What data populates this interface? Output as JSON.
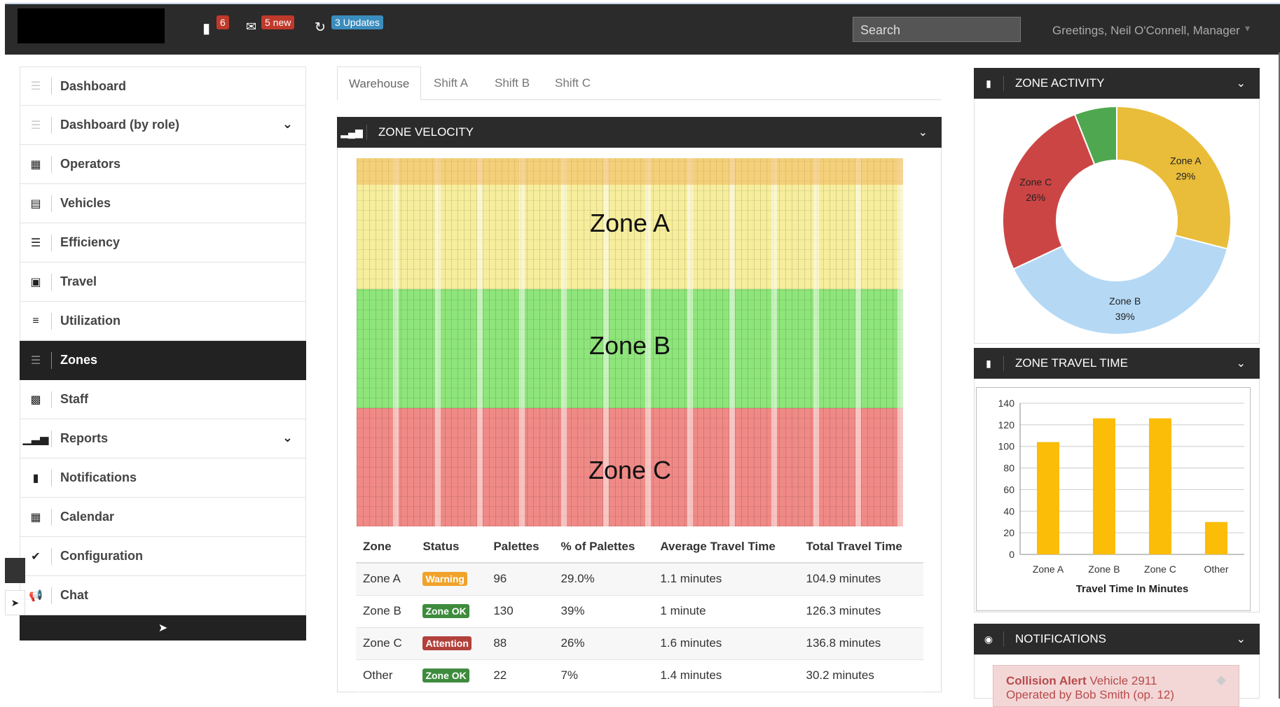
{
  "topbar": {
    "messages_count": "6",
    "mail_badge": "5 new",
    "updates_badge": "3 Updates",
    "search_placeholder": "Search",
    "greeting": "Greetings, Neil O'Connell, Manager"
  },
  "sidebar": {
    "items": [
      {
        "label": "Dashboard",
        "icon": "dashboard-icon"
      },
      {
        "label": "Dashboard (by role)",
        "icon": "dashboard-icon"
      },
      {
        "label": "Operators",
        "icon": "grid-icon"
      },
      {
        "label": "Vehicles",
        "icon": "list-icon"
      },
      {
        "label": "Efficiency",
        "icon": "stack-icon"
      },
      {
        "label": "Travel",
        "icon": "picture-icon"
      },
      {
        "label": "Utilization",
        "icon": "align-icon"
      },
      {
        "label": "Zones",
        "icon": "zones-icon"
      },
      {
        "label": "Staff",
        "icon": "gift-icon"
      },
      {
        "label": "Reports",
        "icon": "bar-chart-icon"
      },
      {
        "label": "Notifications",
        "icon": "comment-icon"
      },
      {
        "label": "Calendar",
        "icon": "calendar-icon"
      },
      {
        "label": "Configuration",
        "icon": "check-icon"
      },
      {
        "label": "Chat",
        "icon": "megaphone-icon"
      }
    ]
  },
  "tabs": [
    "Warehouse",
    "Shift A",
    "Shift B",
    "Shift C"
  ],
  "zone_velocity": {
    "title": "ZONE VELOCITY",
    "zones": [
      "Zone A",
      "Zone B",
      "Zone C"
    ],
    "table": {
      "headers": [
        "Zone",
        "Status",
        "Palettes",
        "% of Palettes",
        "Average Travel Time",
        "Total Travel Time"
      ],
      "rows": [
        {
          "zone": "Zone A",
          "status": "Warning",
          "palettes": "96",
          "pct": "29.0%",
          "avg": "1.1 minutes",
          "total": "104.9 minutes"
        },
        {
          "zone": "Zone B",
          "status": "Zone OK",
          "palettes": "130",
          "pct": "39%",
          "avg": "1 minute",
          "total": "126.3 minutes"
        },
        {
          "zone": "Zone C",
          "status": "Attention",
          "palettes": "88",
          "pct": "26%",
          "avg": "1.6 minutes",
          "total": "136.8 minutes"
        },
        {
          "zone": "Other",
          "status": "Zone OK",
          "palettes": "22",
          "pct": "7%",
          "avg": "1.4 minutes",
          "total": "30.2 minutes"
        }
      ]
    }
  },
  "zone_activity": {
    "title": "ZONE ACTIVITY",
    "slices": [
      {
        "name": "Zone A",
        "label": "29%",
        "value": 29,
        "color": "#e9bd3a"
      },
      {
        "name": "Zone B",
        "label": "39%",
        "value": 39,
        "color": "#b5d9f5"
      },
      {
        "name": "Zone C",
        "label": "26%",
        "value": 26,
        "color": "#cc4545"
      },
      {
        "name": "",
        "label": "",
        "value": 6,
        "color": "#4fa84f"
      }
    ]
  },
  "zone_travel": {
    "title": "ZONE TRAVEL TIME"
  },
  "chart_data": [
    {
      "type": "pie",
      "title": "ZONE ACTIVITY",
      "categories": [
        "Zone A",
        "Zone B",
        "Zone C",
        ""
      ],
      "values": [
        29,
        39,
        26,
        6
      ]
    },
    {
      "type": "bar",
      "title": "ZONE TRAVEL TIME",
      "categories": [
        "Zone A",
        "Zone B",
        "Zone C",
        "Other"
      ],
      "values": [
        104,
        126,
        126,
        30
      ],
      "xlabel": "Travel Time In Minutes",
      "ylabel": "",
      "ylim": [
        0,
        140
      ],
      "yticks": [
        0,
        20,
        40,
        60,
        80,
        100,
        120,
        140
      ],
      "color": "#fbbd08"
    }
  ],
  "notifications": {
    "title": "NOTIFICATIONS",
    "card_title": "Collision Alert",
    "card_text": "Vehicle 2911",
    "card_sub": "Operated by Bob Smith (op. 12)"
  }
}
